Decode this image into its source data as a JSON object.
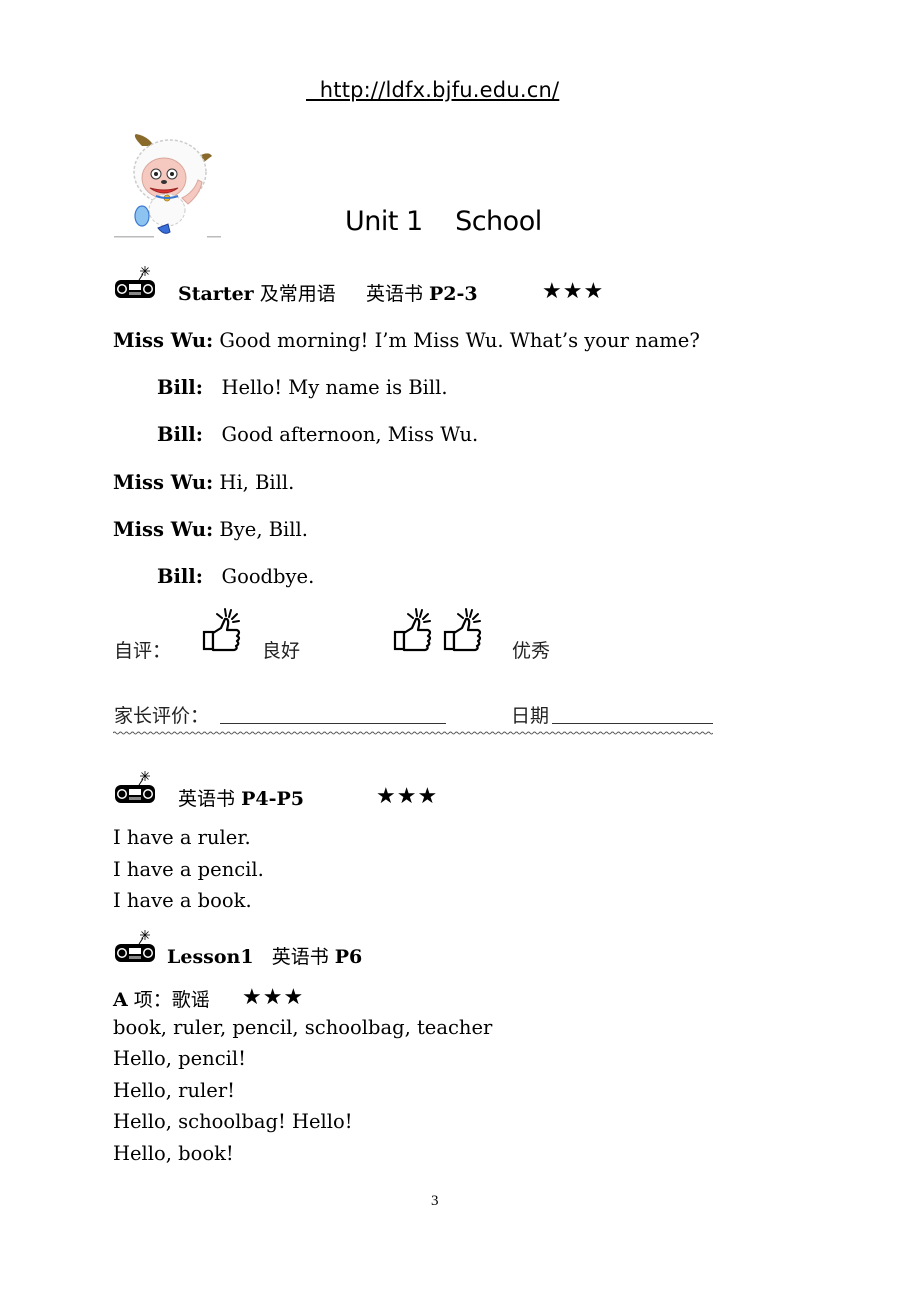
{
  "header": {
    "url": "  http://ldfx.bjfu.edu.cn/"
  },
  "title": {
    "unit": "Unit 1",
    "name": "School"
  },
  "sections": [
    {
      "icon": "radio-icon",
      "title_bold": "Starter",
      "title_cn": " 及常用语",
      "book_cn": "英语书",
      "book_pages": "P2-3",
      "stars": "★★★"
    },
    {
      "icon": "radio-icon",
      "book_cn": "英语书",
      "book_pages": "P4-P5",
      "stars": "★★★"
    },
    {
      "icon": "radio-icon",
      "title_bold": "Lesson1",
      "book_cn": "英语书",
      "book_pages": "P6"
    }
  ],
  "dialogue": [
    {
      "speaker": "Miss Wu:",
      "text": " Good morning! I’m Miss Wu. What’s your name?"
    },
    {
      "speaker": "Bill:",
      "text": "   Hello! My name is Bill."
    },
    {
      "speaker": "Bill:",
      "text": "   Good afternoon, Miss Wu."
    },
    {
      "speaker": "Miss Wu:",
      "text": " Hi, Bill."
    },
    {
      "speaker": "Miss Wu:",
      "text": " Bye, Bill."
    },
    {
      "speaker": "Bill:",
      "text": "   Goodbye."
    }
  ],
  "self_eval": {
    "label": "自评：",
    "good": "良好",
    "excellent": "优秀"
  },
  "parent_eval": {
    "label": "家长评价：",
    "date_label": "日期"
  },
  "sentences": [
    "I have a ruler.",
    "I have a pencil.",
    "I have a book."
  ],
  "part_a": {
    "label_bold": "A",
    "label_cn": " 项：歌谣",
    "stars": "★★★"
  },
  "chant": [
    "book, ruler, pencil, schoolbag, teacher",
    "Hello, pencil!",
    "Hello, ruler!",
    "Hello, schoolbag! Hello!",
    "Hello, book!"
  ],
  "page_number": "3"
}
